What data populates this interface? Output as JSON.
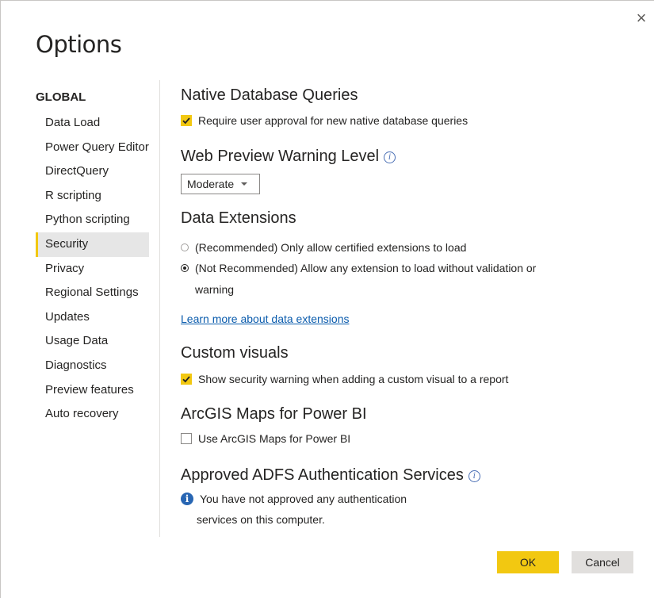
{
  "dialog": {
    "title": "Options",
    "close_glyph": "×"
  },
  "sidebar": {
    "heading": "GLOBAL",
    "items": [
      {
        "label": "Data Load"
      },
      {
        "label": "Power Query Editor"
      },
      {
        "label": "DirectQuery"
      },
      {
        "label": "R scripting"
      },
      {
        "label": "Python scripting"
      },
      {
        "label": "Security",
        "selected": true
      },
      {
        "label": "Privacy"
      },
      {
        "label": "Regional Settings"
      },
      {
        "label": "Updates"
      },
      {
        "label": "Usage Data"
      },
      {
        "label": "Diagnostics"
      },
      {
        "label": "Preview features"
      },
      {
        "label": "Auto recovery"
      }
    ]
  },
  "sections": {
    "native_queries": {
      "title": "Native Database Queries",
      "option_label": "Require user approval for new native database queries",
      "checked": true
    },
    "web_preview": {
      "title": "Web Preview Warning Level",
      "selected_value": "Moderate"
    },
    "data_extensions": {
      "title": "Data Extensions",
      "option1_label": "(Recommended) Only allow certified extensions to load",
      "option1_checked": false,
      "option2_label_line1": "(Not Recommended) Allow any extension to load without validation or",
      "option2_label_line2": "warning",
      "option2_checked": true,
      "learn_more_link": "Learn more about data extensions"
    },
    "custom_visuals": {
      "title": "Custom visuals",
      "option_label": "Show security warning when adding a custom visual to a report",
      "checked": true
    },
    "arcgis": {
      "title": "ArcGIS Maps for Power BI",
      "option_label": "Use ArcGIS Maps for Power BI",
      "checked": false
    },
    "adfs": {
      "title": "Approved ADFS Authentication Services",
      "message_line1": "You have not approved any authentication",
      "message_line2": "services on this computer."
    }
  },
  "buttons": {
    "ok": "OK",
    "cancel": "Cancel"
  },
  "colors": {
    "accent": "#f2c811",
    "link": "#0b5cad",
    "info": "#2866b3",
    "selected_bg": "#e6e6e6"
  }
}
